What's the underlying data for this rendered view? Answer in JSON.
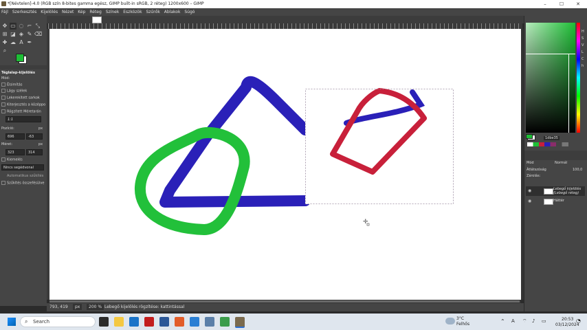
{
  "window": {
    "title": "*[Névtelen]-4.0 (RGB szín 8-bites gamma egész, GIMP built-in sRGB, 2 réteg) 1200x600 – GIMP",
    "minimize": "–",
    "maximize": "☐",
    "close": "✕"
  },
  "menu": [
    "Fájl",
    "Szerkesztés",
    "Kijelölés",
    "Nézet",
    "Kép",
    "Réteg",
    "Színek",
    "Eszközök",
    "Szűrők",
    "Ablakok",
    "Súgó"
  ],
  "colors": {
    "foreground": "#1dbe35",
    "background": "#ffffff",
    "blue_stroke": "#2a20b8",
    "green_stroke": "#22c03a",
    "red_stroke": "#c8203a"
  },
  "tool_options": {
    "title": "Téglalap-kijelölés",
    "mode_label": "Mód:",
    "antialias": "Élsimítás",
    "feather": "Lágy szélek",
    "rounded": "Lekerekített sarkok",
    "expand_center": "Kiterjesztés a középpo",
    "fixed_label": "Rögzített",
    "fixed_value": "Méretarán",
    "ratio": "1:1",
    "position_label": "Pozíció:",
    "position_unit": "px",
    "pos_x": "696",
    "pos_y": "-63",
    "size_label": "Méret:",
    "size_unit": "px",
    "size_w": "323",
    "size_h": "314",
    "highlight": "Kiemelés",
    "guides": "Nincs segédvonal",
    "auto_shrink": "Automatikus szűkítés",
    "shrink_merged": "Szűkítés összefésülve"
  },
  "status": {
    "coords": "793, 419",
    "unit": "px",
    "zoom": "200 %",
    "message": "Lebegő kijelölés rögzítése: kattintással"
  },
  "right_panel": {
    "fg_hex": "1dbe35",
    "mode_label": "Mód",
    "mode_value": "Normál",
    "opacity_label": "Átlátszóság",
    "opacity_value": "100,0",
    "lock_label": "Zárolás:",
    "layers": [
      {
        "name": "Lebegő kijelölés\n(Lebegő réteg)"
      },
      {
        "name": "Háttér"
      }
    ]
  },
  "taskbar": {
    "search_placeholder": "Search",
    "weather_temp": "3°C",
    "weather_desc": "Felhős",
    "time": "20:53",
    "date": "03/12/2024"
  }
}
